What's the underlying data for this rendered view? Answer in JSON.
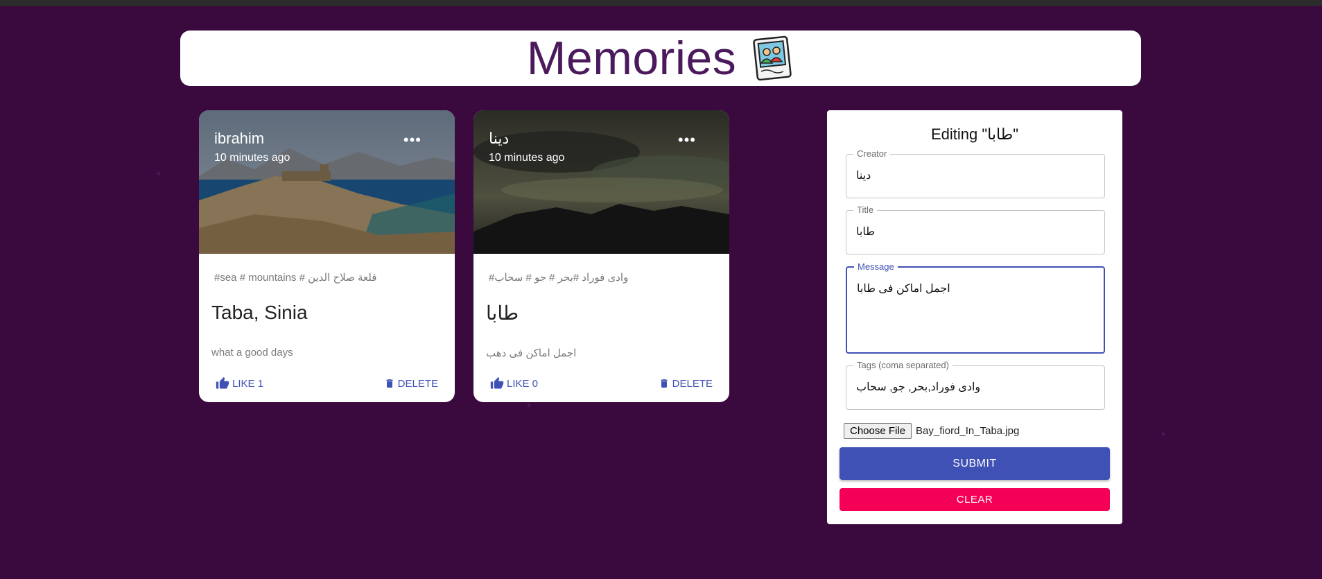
{
  "app": {
    "title": "Memories"
  },
  "posts": [
    {
      "creator": "ibrahim",
      "time": "10 minutes ago",
      "tags": "#sea # mountains # قلعة صلاح الدين",
      "title": "Taba, Sinia",
      "message": "what a good days",
      "like_label": "LIKE 1",
      "delete_label": "DELETE",
      "more": "•••"
    },
    {
      "creator": "دينا",
      "time": "10 minutes ago",
      "tags": "#وادى فوراد #بحر # جو # سحاب",
      "title": "طابا",
      "message": "اجمل اماكن فى دهب",
      "like_label": "LIKE 0",
      "delete_label": "DELETE",
      "more": "•••"
    }
  ],
  "form": {
    "heading": "Editing \"طابا\"",
    "creator": {
      "label": "Creator",
      "value": "دينا"
    },
    "title": {
      "label": "Title",
      "value": "طابا"
    },
    "message": {
      "label": "Message",
      "value": "اجمل اماكن فى طابا"
    },
    "tags": {
      "label": "Tags (coma separated)",
      "value": "وادى فوراد,بحر, جو, سحاب"
    },
    "file_button": "Choose File",
    "file_name": "Bay_fiord_In_Taba.jpg",
    "submit_label": "SUBMIT",
    "clear_label": "CLEAR"
  }
}
